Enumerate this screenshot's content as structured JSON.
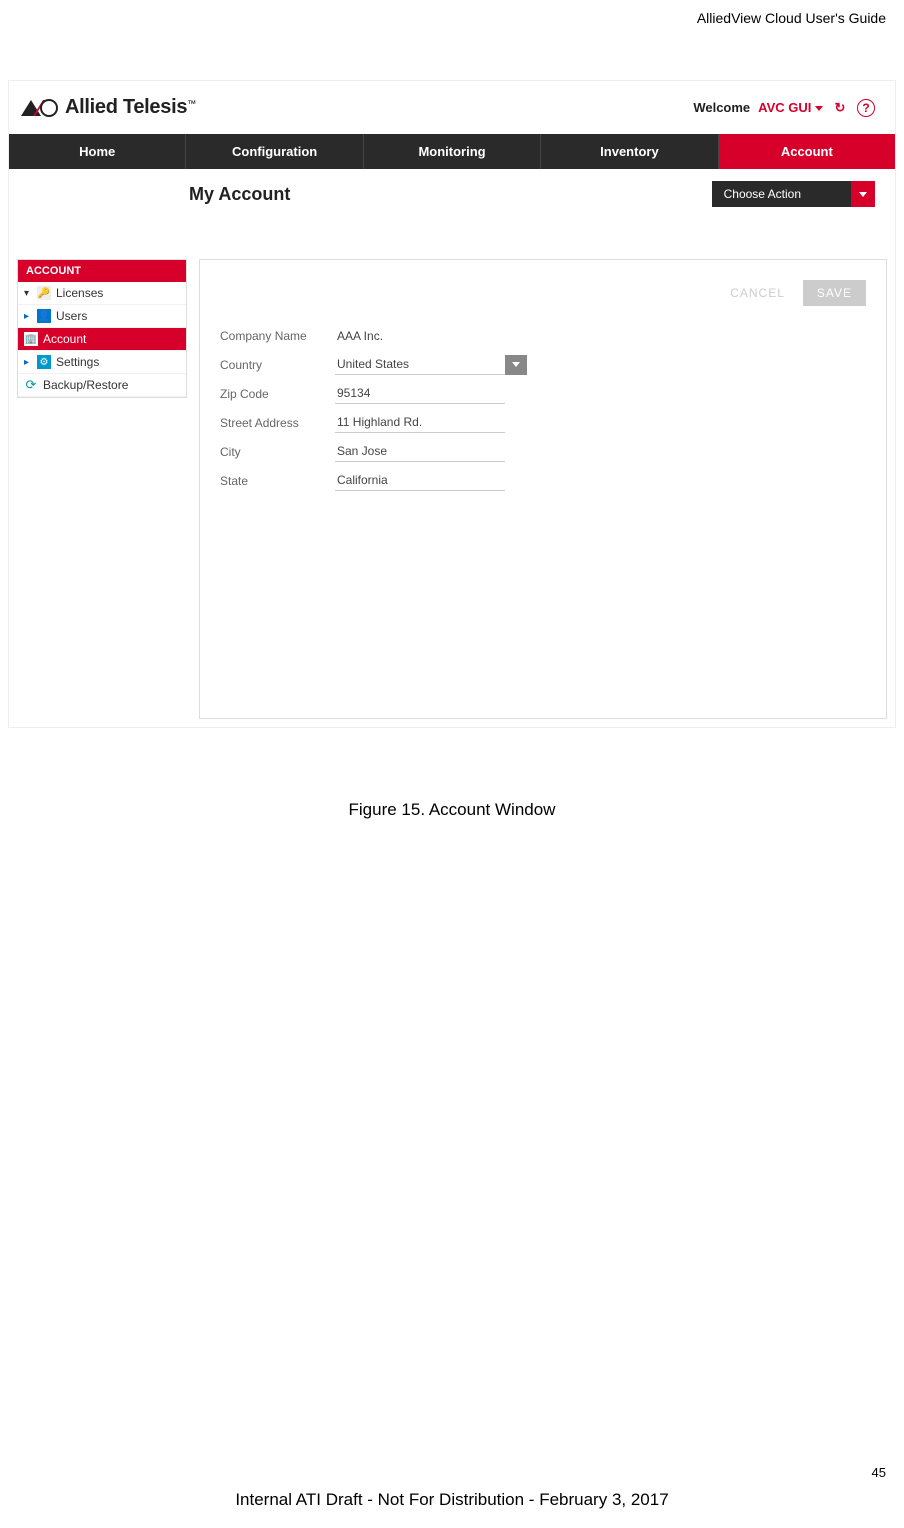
{
  "doc": {
    "header_right": "AlliedView Cloud User's Guide",
    "figure_caption": "Figure 15. Account Window",
    "page_number": "45",
    "footer": "Internal ATI Draft - Not For Distribution - February 3, 2017"
  },
  "logo": {
    "text": "Allied Telesis",
    "tm": "™"
  },
  "welcome": {
    "label": "Welcome",
    "user": "AVC GUI"
  },
  "nav": {
    "items": [
      "Home",
      "Configuration",
      "Monitoring",
      "Inventory",
      "Account"
    ]
  },
  "page": {
    "title": "My Account"
  },
  "choose_action": {
    "label": "Choose Action"
  },
  "sidebar": {
    "header": "ACCOUNT",
    "items": [
      {
        "label": "Licenses"
      },
      {
        "label": "Users"
      },
      {
        "label": "Account"
      },
      {
        "label": "Settings"
      },
      {
        "label": "Backup/Restore"
      }
    ]
  },
  "buttons": {
    "cancel": "CANCEL",
    "save": "SAVE"
  },
  "form": {
    "company_name": {
      "label": "Company Name",
      "value": "AAA Inc."
    },
    "country": {
      "label": "Country",
      "value": "United States"
    },
    "zip": {
      "label": "Zip Code",
      "value": "95134"
    },
    "street": {
      "label": "Street Address",
      "value": "11 Highland Rd."
    },
    "city": {
      "label": "City",
      "value": "San Jose"
    },
    "state": {
      "label": "State",
      "value": "California"
    }
  }
}
